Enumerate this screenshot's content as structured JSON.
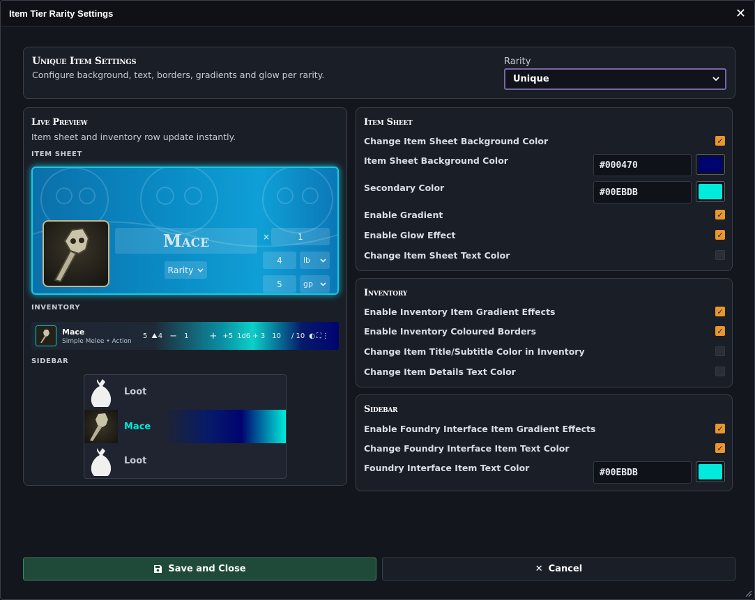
{
  "window": {
    "title": "Item Tier Rarity Settings"
  },
  "header": {
    "title": "Unique Item Settings",
    "subtitle": "Configure background, text, borders, gradients and glow per rarity.",
    "rarity_label": "Rarity",
    "rarity_value": "Unique"
  },
  "preview": {
    "title": "Live Preview",
    "subtitle": "Item sheet and inventory row update instantly.",
    "item_sheet_label": "ITEM SHEET",
    "inventory_label": "INVENTORY",
    "sidebar_label": "SIDEBAR",
    "sheet": {
      "item_name": "Mace",
      "rarity_dropdown": "Rarity",
      "qty_prefix": "×",
      "qty": "1",
      "weight": "4",
      "weight_unit": "lb",
      "price": "5",
      "price_unit": "gp"
    },
    "inventory_row": {
      "name": "Mace",
      "subtitle": "Simple Melee • Action",
      "weight": "5",
      "bulk": "4",
      "minus": "−",
      "qty": "1",
      "plus": "+",
      "to_hit": "+5",
      "damage": "1d6 + 3",
      "range": "10",
      "uses": "/ 10"
    },
    "sidebar_items": [
      {
        "label": "Loot"
      },
      {
        "label": "Mace"
      },
      {
        "label": "Loot"
      }
    ]
  },
  "item_sheet": {
    "title": "Item Sheet",
    "rows": [
      {
        "label": "Change Item Sheet Background Color",
        "checked": true
      },
      {
        "label": "Item Sheet Background Color",
        "hex": "#000470"
      },
      {
        "label": "Secondary Color",
        "hex": "#00EBDB"
      },
      {
        "label": "Enable Gradient",
        "checked": true
      },
      {
        "label": "Enable Glow Effect",
        "checked": true
      },
      {
        "label": "Change Item Sheet Text Color",
        "checked": false
      }
    ]
  },
  "inventory": {
    "title": "Inventory",
    "rows": [
      {
        "label": "Enable Inventory Item Gradient Effects",
        "checked": true
      },
      {
        "label": "Enable Inventory Coloured Borders",
        "checked": true
      },
      {
        "label": "Change Item Title/Subtitle Color in Inventory",
        "checked": false
      },
      {
        "label": "Change Item Details Text Color",
        "checked": false
      }
    ]
  },
  "sidebar": {
    "title": "Sidebar",
    "rows": [
      {
        "label": "Enable Foundry Interface Item Gradient Effects",
        "checked": true
      },
      {
        "label": "Change Foundry Interface Item Text Color",
        "checked": true
      },
      {
        "label": "Foundry Interface Item Text Color",
        "hex": "#00EBDB"
      }
    ]
  },
  "footer": {
    "save_label": "Save and Close",
    "cancel_label": "Cancel"
  },
  "colors": {
    "accent": "#e8962e",
    "primary": "#000470",
    "secondary": "#00EBDB"
  }
}
